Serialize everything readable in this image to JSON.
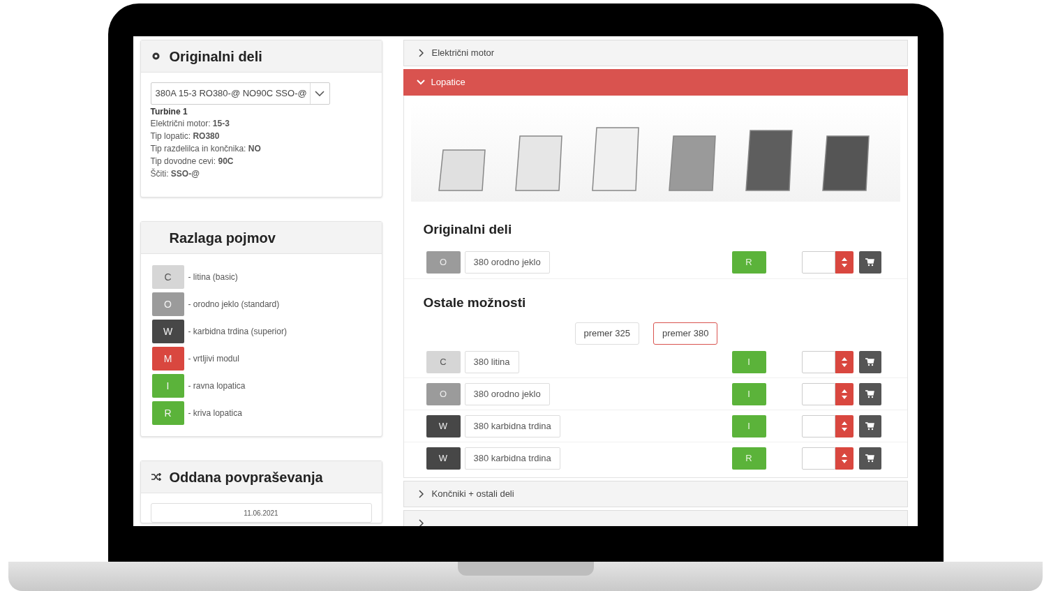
{
  "original_parts": {
    "title": "Originalni deli",
    "select_value": "380A 15-3 RO380-@ NO90C SSO-@",
    "turbine": "Turbine 1",
    "specs": [
      "Električni motor: **15-3**",
      "Tip lopatic: **RO380**",
      "Tip razdelilca in končnika: **NO**",
      "Tip dovodne cevi: **90C**",
      "Ščiti: **SSO-@**"
    ]
  },
  "legend": {
    "title": "Razlaga pojmov",
    "items": [
      {
        "code": "C",
        "color": "#d6d6d6",
        "text": "- litina (basic)"
      },
      {
        "code": "O",
        "color": "#9b9b9b",
        "text": "- orodno jeklo (standard)"
      },
      {
        "code": "W",
        "color": "#474747",
        "text": "- karbidna trdina (superior)"
      },
      {
        "code": "M",
        "color": "#d9473f",
        "text": "- vrtljivi modul"
      },
      {
        "code": "I",
        "color": "#5bb33a",
        "text": "- ravna lopatica"
      },
      {
        "code": "R",
        "color": "#5bb33a",
        "text": "- kriva lopatica"
      }
    ]
  },
  "inquiries": {
    "title": "Oddana povpraševanja",
    "dates": [
      "11.06.2021"
    ]
  },
  "accordion": [
    {
      "title": "Električni motor",
      "expanded": false
    },
    {
      "title": "Lopatice",
      "expanded": true,
      "original_heading": "Originalni deli",
      "original_rows": [
        {
          "code": "O",
          "color": "#9b9b9b",
          "name": "380 orodno jeklo",
          "type": "R"
        }
      ],
      "other_heading": "Ostale možnosti",
      "diameters": [
        {
          "label": "premer 325",
          "selected": false
        },
        {
          "label": "premer 380",
          "selected": true
        }
      ],
      "other_rows": [
        {
          "code": "C",
          "color": "#d6d6d6",
          "name": "380 litina",
          "type": "I"
        },
        {
          "code": "O",
          "color": "#9b9b9b",
          "name": "380 orodno jeklo",
          "type": "I"
        },
        {
          "code": "W",
          "color": "#474747",
          "name": "380 karbidna trdina",
          "type": "I"
        },
        {
          "code": "W",
          "color": "#474747",
          "name": "380 karbidna trdina",
          "type": "R"
        }
      ]
    },
    {
      "title": "Končniki + ostali deli",
      "expanded": false
    },
    {
      "expanded": false
    }
  ]
}
